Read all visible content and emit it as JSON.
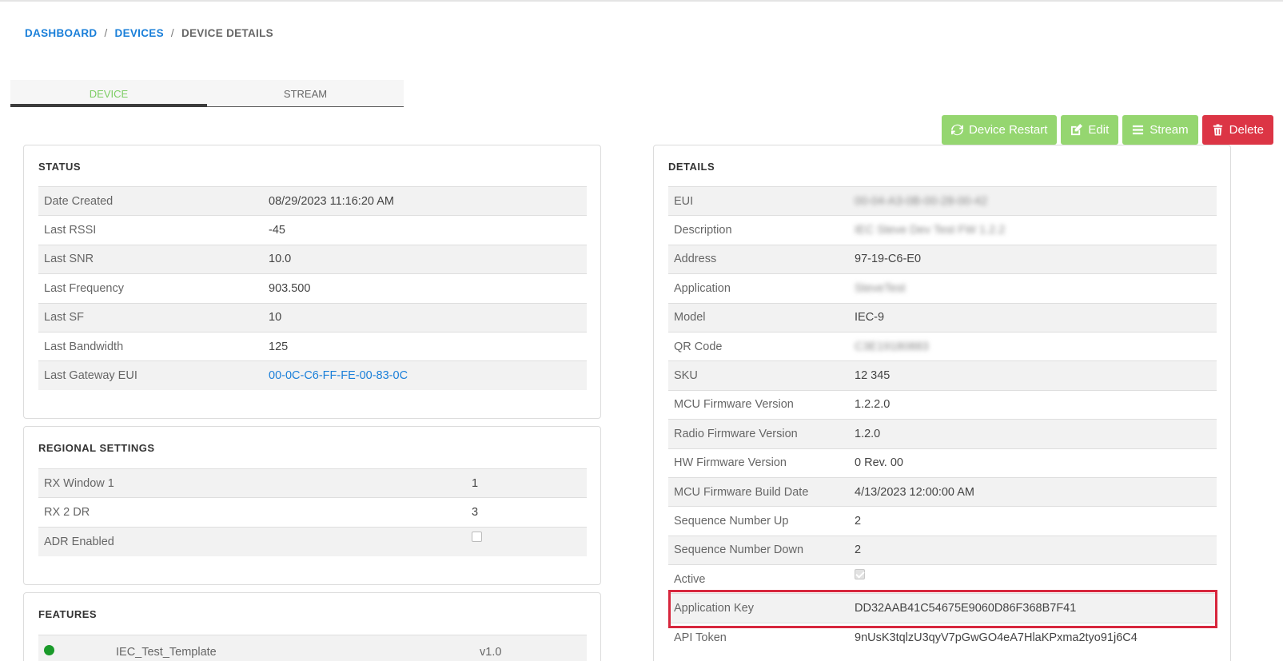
{
  "breadcrumb": {
    "dashboard": "DASHBOARD",
    "devices": "DEVICES",
    "separator": "/",
    "current": "DEVICE DETAILS"
  },
  "tabs": [
    {
      "label": "DEVICE",
      "active": true
    },
    {
      "label": "STREAM",
      "active": false
    }
  ],
  "actions": {
    "restart": "Device Restart",
    "edit": "Edit",
    "stream": "Stream",
    "delete": "Delete"
  },
  "status": {
    "title": "STATUS",
    "rows": [
      {
        "label": "Date Created",
        "value": "08/29/2023 11:16:20 AM"
      },
      {
        "label": "Last RSSI",
        "value": "-45"
      },
      {
        "label": "Last SNR",
        "value": "10.0"
      },
      {
        "label": "Last Frequency",
        "value": "903.500"
      },
      {
        "label": "Last SF",
        "value": "10"
      },
      {
        "label": "Last Bandwidth",
        "value": "125"
      },
      {
        "label": "Last Gateway EUI",
        "value": "00-0C-C6-FF-FE-00-83-0C"
      }
    ]
  },
  "regional": {
    "title": "REGIONAL SETTINGS",
    "rows": [
      {
        "label": "RX Window 1",
        "value": "1"
      },
      {
        "label": "RX 2 DR",
        "value": "3"
      },
      {
        "label": "ADR Enabled",
        "checked": false
      }
    ]
  },
  "features": {
    "title": "FEATURES",
    "rows": [
      {
        "name": "IEC_Test_Template",
        "version": "v1.0"
      }
    ]
  },
  "details": {
    "title": "DETAILS",
    "rows": [
      {
        "label": "EUI",
        "value": "00-04-A3-0B-00-28-00-42",
        "blurred": true
      },
      {
        "label": "Description",
        "value": "IEC Steve Dev Test FW 1.2.2",
        "blurred": true
      },
      {
        "label": "Address",
        "value": "97-19-C6-E0"
      },
      {
        "label": "Application",
        "value": "SteveTest",
        "blurred": true
      },
      {
        "label": "Model",
        "value": "IEC-9"
      },
      {
        "label": "QR Code",
        "value": "C3E19180883",
        "blurred": true
      },
      {
        "label": "SKU",
        "value": "12 345"
      },
      {
        "label": "MCU Firmware Version",
        "value": "1.2.2.0"
      },
      {
        "label": "Radio Firmware Version",
        "value": "1.2.0"
      },
      {
        "label": "HW Firmware Version",
        "value": "0 Rev. 00"
      },
      {
        "label": "MCU Firmware Build Date",
        "value": "4/13/2023 12:00:00 AM"
      },
      {
        "label": "Sequence Number Up",
        "value": "2"
      },
      {
        "label": "Sequence Number Down",
        "value": "2"
      },
      {
        "label": "Active",
        "checked": true
      },
      {
        "label": "Application Key",
        "value": "DD32AAB41C54675E9060D86F368B7F41"
      },
      {
        "label": "API Token",
        "value": "9nUsK3tqlzU3qyV7pGwGO4eA7HlaKPxma2tyo91j6C4"
      }
    ]
  },
  "colors": {
    "link": "#1a7fd9",
    "tab_active": "#7ccd63",
    "button_green": "#95d670",
    "button_red": "#dc3545",
    "highlight": "#d7263d"
  }
}
